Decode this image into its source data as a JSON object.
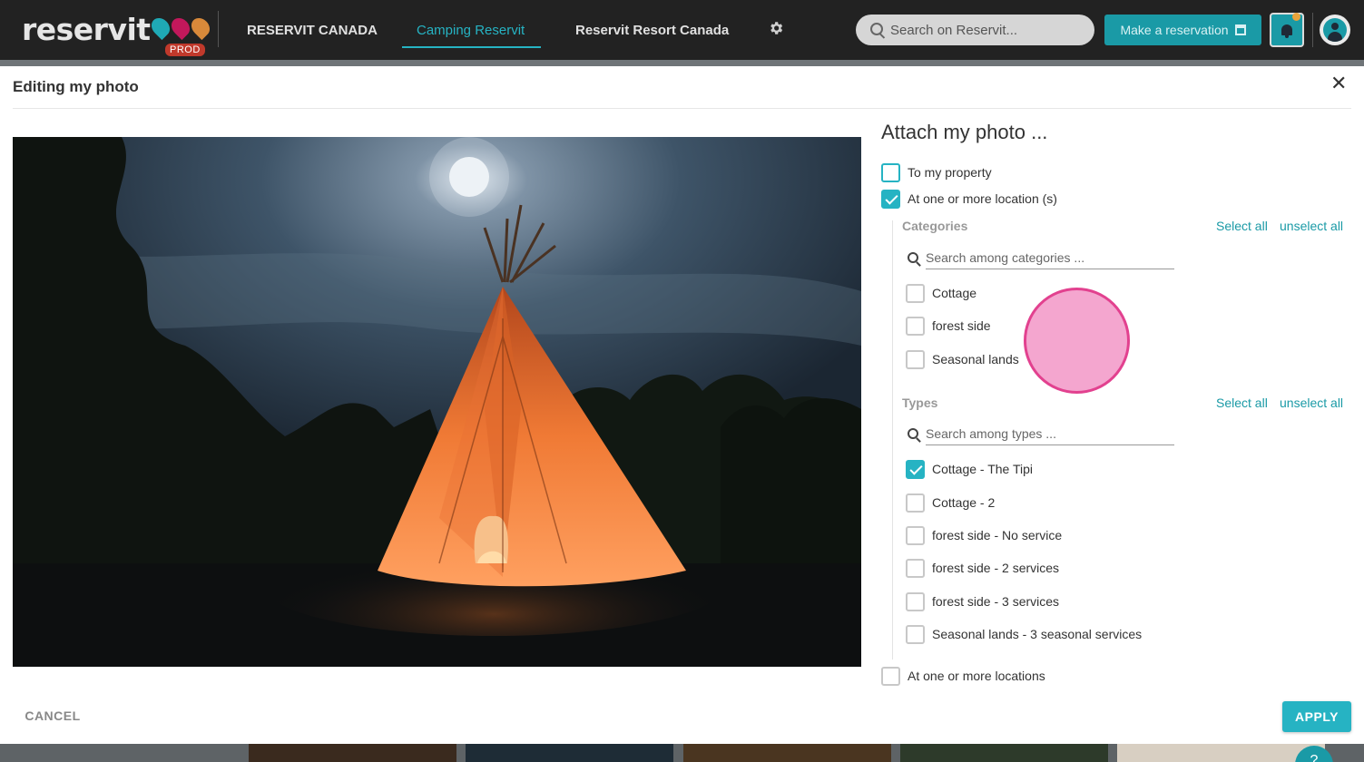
{
  "brand": {
    "logo_text": "reservit",
    "env_badge": "PROD"
  },
  "nav": {
    "items": [
      {
        "label": "RESERVIT CANADA"
      },
      {
        "label": "Camping Reservit",
        "active": true
      },
      {
        "label": "Reservit Resort Canada"
      }
    ]
  },
  "header": {
    "search_placeholder": "Search on Reservit...",
    "make_reservation": "Make a reservation"
  },
  "modal": {
    "title": "Editing my photo",
    "attach_title": "Attach my photo ...",
    "to_property": "To my property",
    "at_locations_s": "At one or more location (s)",
    "at_locations": "At one or more locations",
    "categories": {
      "label": "Categories",
      "select_all": "Select all",
      "unselect_all": "unselect all",
      "search_placeholder": "Search among categories ...",
      "items": [
        "Cottage",
        "forest side",
        "Seasonal lands"
      ]
    },
    "types": {
      "label": "Types",
      "select_all": "Select all",
      "unselect_all": "unselect all",
      "search_placeholder": "Search among types ...",
      "items": [
        {
          "label": "Cottage - The Tipi",
          "checked": true
        },
        {
          "label": "Cottage - 2",
          "checked": false
        },
        {
          "label": "forest side - No service",
          "checked": false
        },
        {
          "label": "forest side - 2 services",
          "checked": false
        },
        {
          "label": "forest side - 3 services",
          "checked": false
        },
        {
          "label": "Seasonal lands - 3 seasonal services",
          "checked": false
        }
      ]
    },
    "cancel": "CANCEL",
    "apply": "APPLY"
  },
  "help": {
    "label": "?"
  },
  "colors": {
    "accent": "#26b3c3",
    "accent_dark": "#1a9aa6",
    "topbar": "#222222",
    "prod": "#c0392b"
  }
}
